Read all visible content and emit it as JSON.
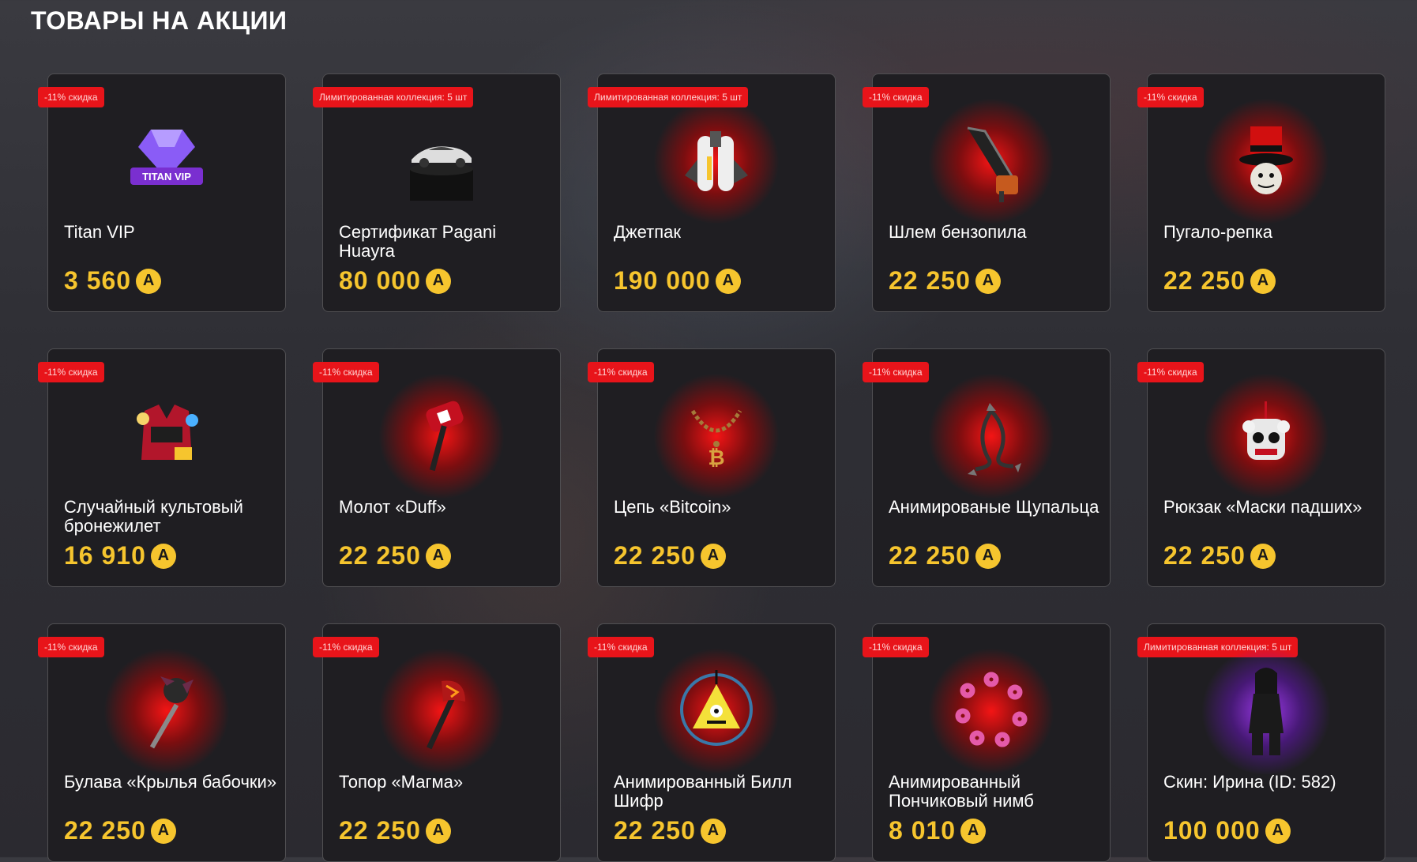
{
  "page": {
    "title": "ТОВАРЫ НА АКЦИИ"
  },
  "currency_icon": "А",
  "colors": {
    "badge": "#e8141a",
    "price": "#f6c52e",
    "card_bg": "#1f1e22"
  },
  "products": [
    {
      "badge": "-11% скидка",
      "name": "Titan VIP",
      "price": "3 560",
      "icon": "diamond-icon",
      "glow": "none"
    },
    {
      "badge": "Лимитированная коллекция: 5 шт",
      "name": "Сертификат Pagani Huayra",
      "price": "80 000",
      "icon": "car-icon",
      "glow": "none"
    },
    {
      "badge": "Лимитированная коллекция: 5 шт",
      "name": "Джетпак",
      "price": "190 000",
      "icon": "jetpack-icon",
      "glow": "red"
    },
    {
      "badge": "-11% скидка",
      "name": "Шлем бензопила",
      "price": "22 250",
      "icon": "chainsaw-icon",
      "glow": "red"
    },
    {
      "badge": "-11% скидка",
      "name": "Пугало-репка",
      "price": "22 250",
      "icon": "top-hat-icon",
      "glow": "red"
    },
    {
      "badge": "-11% скидка",
      "name": "Случайный культовый бронежилет",
      "price": "16 910",
      "icon": "vest-icon",
      "glow": "none"
    },
    {
      "badge": "-11% скидка",
      "name": "Молот «Duff»",
      "price": "22 250",
      "icon": "hammer-icon",
      "glow": "red"
    },
    {
      "badge": "-11% скидка",
      "name": "Цепь «Bitcoin»",
      "price": "22 250",
      "icon": "chain-icon",
      "glow": "red"
    },
    {
      "badge": "-11% скидка",
      "name": "Анимированые Щупальца",
      "price": "22 250",
      "icon": "tentacles-icon",
      "glow": "red"
    },
    {
      "badge": "-11% скидка",
      "name": "Рюкзак «Маски падших»",
      "price": "22 250",
      "icon": "backpack-icon",
      "glow": "red"
    },
    {
      "badge": "-11% скидка",
      "name": "Булава «Крылья бабочки»",
      "price": "22 250",
      "icon": "mace-icon",
      "glow": "red"
    },
    {
      "badge": "-11% скидка",
      "name": "Топор «Магма»",
      "price": "22 250",
      "icon": "axe-icon",
      "glow": "red"
    },
    {
      "badge": "-11% скидка",
      "name": "Анимированный Билл Шифр",
      "price": "22 250",
      "icon": "triangle-icon",
      "glow": "red"
    },
    {
      "badge": "-11% скидка",
      "name": "Анимированный Пончиковый нимб",
      "price": "8 010",
      "icon": "donut-halo-icon",
      "glow": "red"
    },
    {
      "badge": "Лимитированная коллекция: 5 шт",
      "name": "Скин: Ирина (ID: 582)",
      "price": "100 000",
      "icon": "person-icon",
      "glow": "purple"
    }
  ]
}
